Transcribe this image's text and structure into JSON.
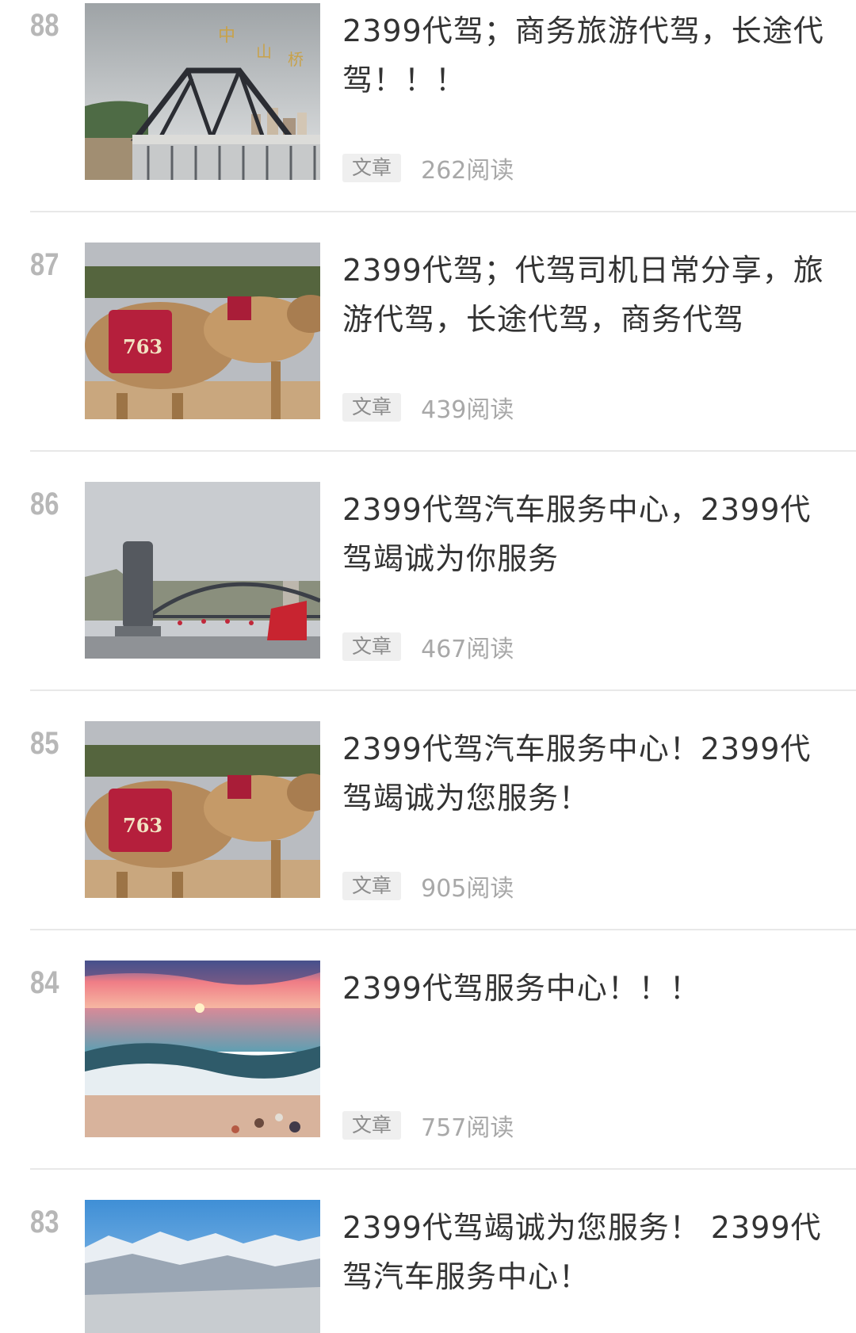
{
  "articles": [
    {
      "rank": "88",
      "title": "2399代驾；商务旅游代驾，长途代驾！！！",
      "tag": "文章",
      "reads": "262阅读",
      "image": "iron-bridge-photo"
    },
    {
      "rank": "87",
      "title": "2399代驾；代驾司机日常分享，旅游代驾，长途代驾，商务代驾",
      "tag": "文章",
      "reads": "439阅读",
      "image": "camels-photo"
    },
    {
      "rank": "86",
      "title": "2399代驾汽车服务中心，2399代驾竭诚为你服务",
      "tag": "文章",
      "reads": "467阅读",
      "image": "monument-bridge-photo"
    },
    {
      "rank": "85",
      "title": "2399代驾汽车服务中心！2399代驾竭诚为您服务！",
      "tag": "文章",
      "reads": "905阅读",
      "image": "camels-photo"
    },
    {
      "rank": "84",
      "title": "2399代驾服务中心！！！",
      "tag": "文章",
      "reads": "757阅读",
      "image": "sunset-beach-photo"
    },
    {
      "rank": "83",
      "title": "2399代驾竭诚为您服务！ 2399代驾汽车服务中心！",
      "tag": "文章",
      "reads": "",
      "image": "snow-mountains-photo"
    }
  ]
}
